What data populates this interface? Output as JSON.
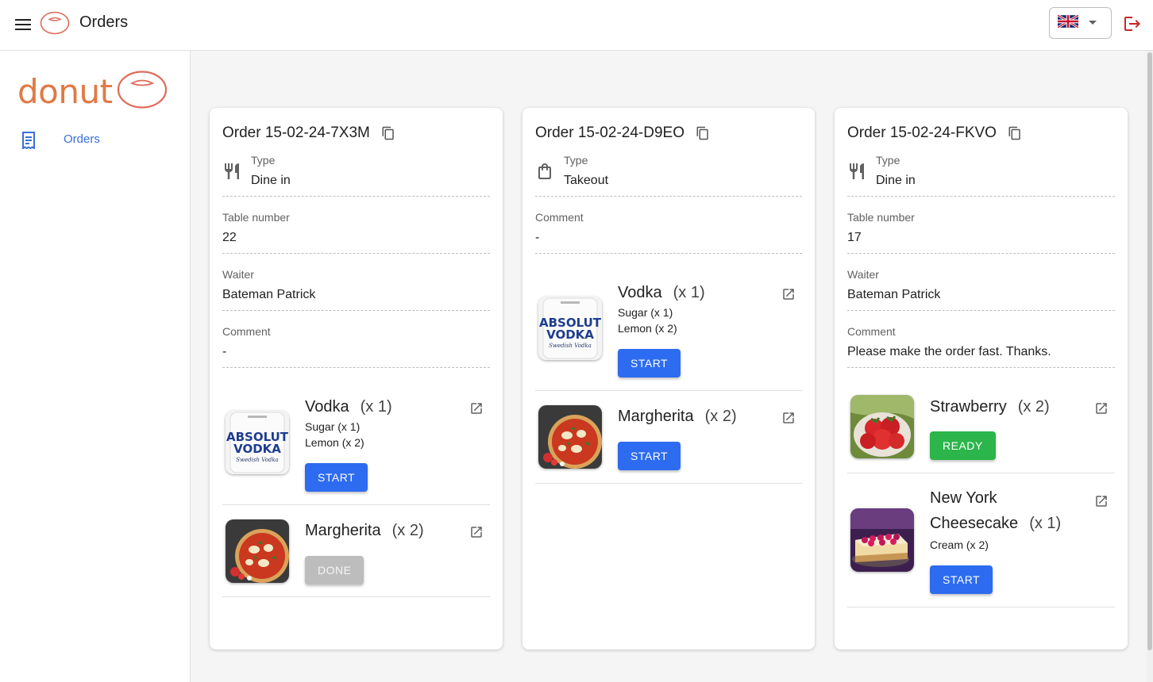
{
  "header": {
    "title": "Orders",
    "language": "English (UK)"
  },
  "sidebar": {
    "brand": "donut",
    "items": [
      {
        "label": "Orders",
        "icon": "receipt-icon"
      }
    ]
  },
  "colors": {
    "primary": "#2d6cf0",
    "done": "#bdbdbd",
    "ready": "#2bb54a",
    "brand": "#e07a45",
    "logout": "#c62828"
  },
  "orders": [
    {
      "title": "Order 15-02-24-7X3M",
      "type_label": "Type",
      "type": "Dine in",
      "table_label": "Table number",
      "table": "22",
      "waiter_label": "Waiter",
      "waiter": "Bateman Patrick",
      "comment_label": "Comment",
      "comment": "-",
      "items": [
        {
          "name": "Vodka",
          "qty": "(x 1)",
          "extras": [
            "Sugar (x 1)",
            "Lemon (x 2)"
          ],
          "image": "absolut-vodka-bottle",
          "status": "START"
        },
        {
          "name": "Margherita",
          "qty": "(x 2)",
          "extras": [],
          "image": "margherita-pizza",
          "status": "DONE"
        }
      ]
    },
    {
      "title": "Order 15-02-24-D9EO",
      "type_label": "Type",
      "type": "Takeout",
      "comment_label": "Comment",
      "comment": "-",
      "items": [
        {
          "name": "Vodka",
          "qty": "(x 1)",
          "extras": [
            "Sugar (x 1)",
            "Lemon (x 2)"
          ],
          "image": "absolut-vodka-bottle",
          "status": "START"
        },
        {
          "name": "Margherita",
          "qty": "(x 2)",
          "extras": [],
          "image": "margherita-pizza",
          "status": "START"
        }
      ]
    },
    {
      "title": "Order 15-02-24-FKVO",
      "type_label": "Type",
      "type": "Dine in",
      "table_label": "Table number",
      "table": "17",
      "waiter_label": "Waiter",
      "waiter": "Bateman Patrick",
      "comment_label": "Comment",
      "comment": "Please make the order fast. Thanks.",
      "items": [
        {
          "name": "Strawberry",
          "qty": "(x 2)",
          "extras": [],
          "image": "strawberries-bowl",
          "status": "READY"
        },
        {
          "name_line1": "New York",
          "name_line2": "Cheesecake",
          "qty": "(x 1)",
          "extras": [
            "Cream (x 2)"
          ],
          "image": "raspberry-cheesecake",
          "status": "START"
        }
      ]
    }
  ]
}
